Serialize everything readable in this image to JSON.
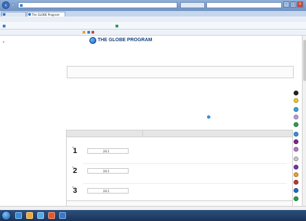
{
  "browser": {
    "url": "",
    "search_placeholder": "",
    "tabs": [
      {
        "label": ""
      },
      {
        "label": "The GLOBE Program"
      }
    ],
    "menu": [
      "",
      "",
      "",
      "",
      "",
      ""
    ],
    "favorites": {
      "left": "",
      "mid": "",
      "right": ""
    },
    "command_bar": ""
  },
  "site": {
    "logo_text": "THE GLOBE PROGRAM",
    "title_ar": "",
    "subtitle": "",
    "link": "",
    "subtitle2": "",
    "user_top_right": ""
  },
  "form": {
    "title": "",
    "note": "",
    "headers": {
      "right": "",
      "left": ""
    },
    "rows": [
      {
        "num": "1",
        "unit": "",
        "value": "24.1",
        "label": ""
      },
      {
        "num": "2",
        "unit": "",
        "value": "24.1",
        "label": ""
      },
      {
        "num": "3",
        "unit": "",
        "value": "24.1",
        "label": ""
      }
    ],
    "bottom_text": ""
  },
  "taskbar": {
    "tray_text": "",
    "clock_time": "",
    "clock_date": ""
  },
  "colors": {
    "side_dots": [
      "#222222",
      "#f2c12e",
      "#39a0d8",
      "#b89ad6",
      "#2f9d4d",
      "#3a8fd6",
      "#7a2a8c",
      "#b07cc4",
      "#c8c8c8",
      "#6b3aa0",
      "#e2a23a",
      "#c0392b",
      "#1f6fc1",
      "#2a9d4a"
    ],
    "taskbar_icons": [
      "#3b8ad6",
      "#f0a83a",
      "#5aa9e6",
      "#e3572b",
      "#3978c9"
    ]
  }
}
